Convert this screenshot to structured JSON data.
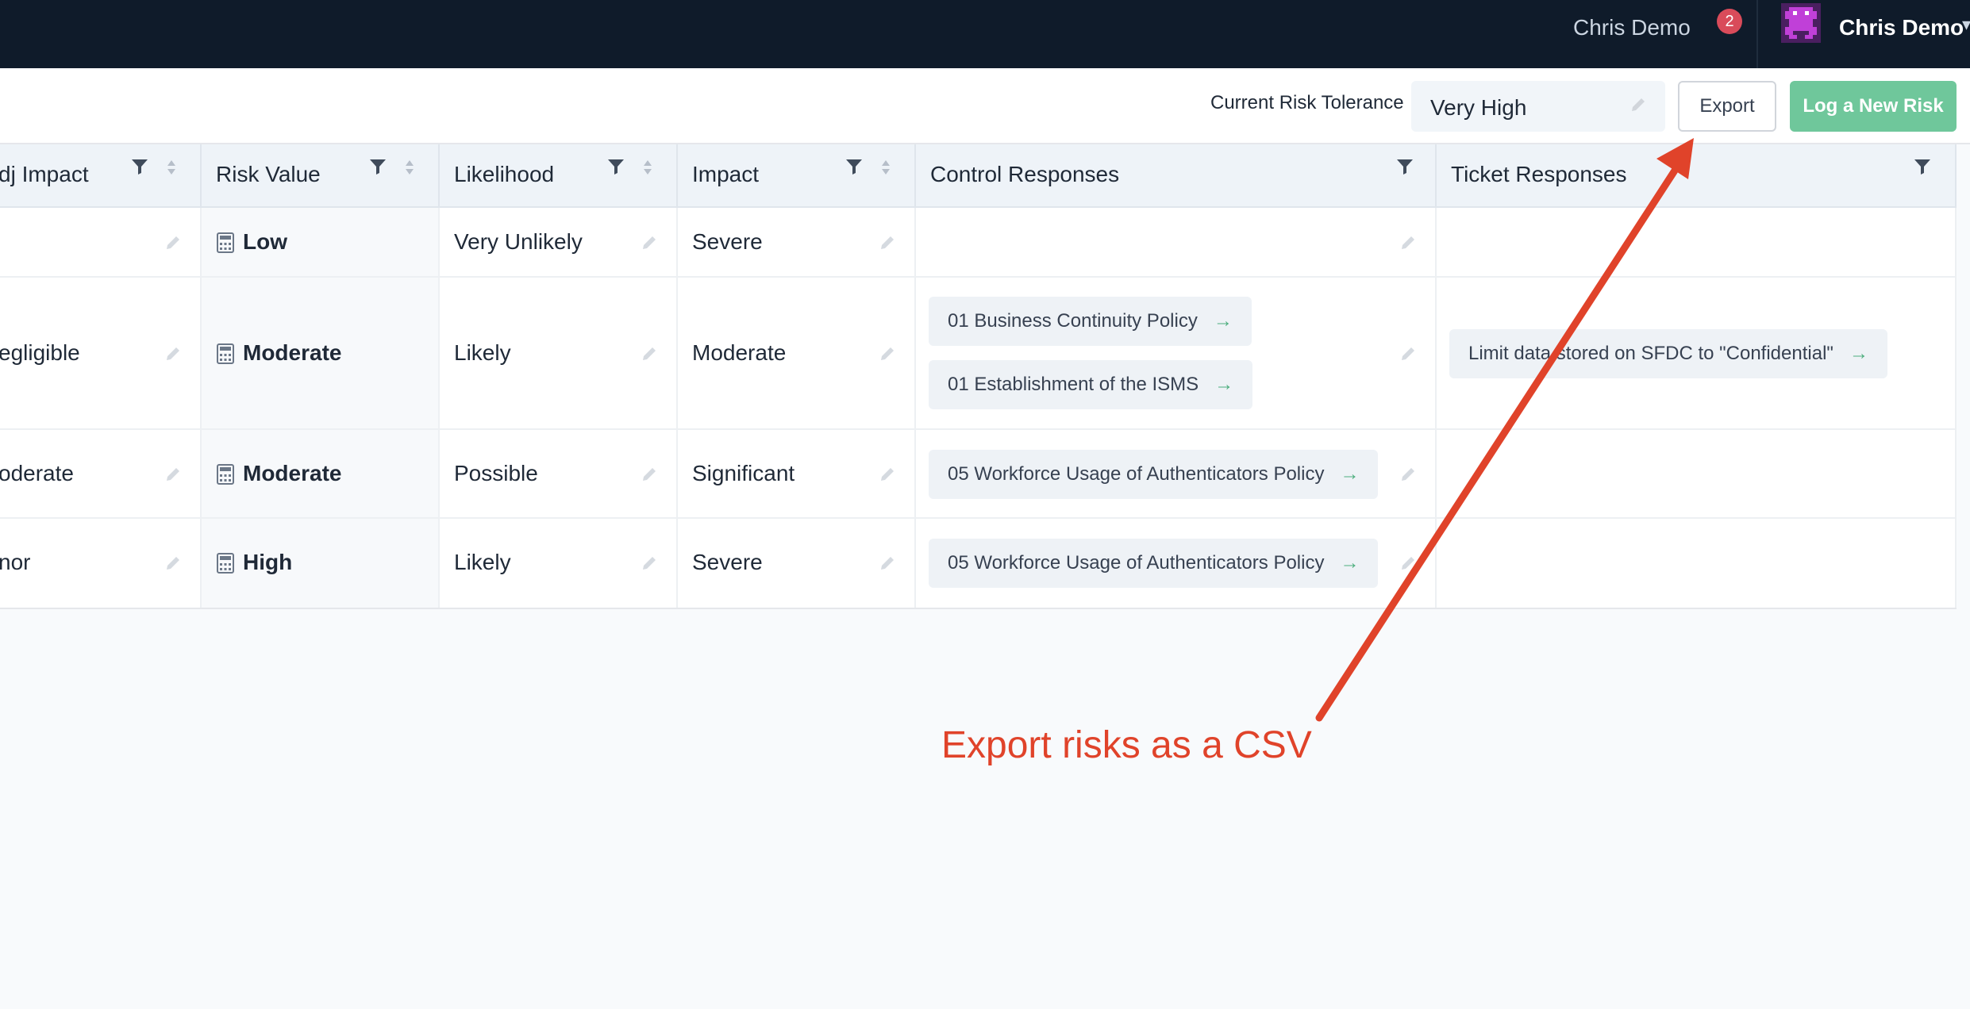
{
  "topbar": {
    "user_link": "Chris Demo",
    "notification_count": "2",
    "account_name": "Chris Demo"
  },
  "toolbar": {
    "tolerance_label": "Current Risk Tolerance",
    "tolerance_value": "Very High",
    "export_label": "Export",
    "log_label": "Log a New Risk"
  },
  "table": {
    "columns": [
      {
        "label": "dj Impact"
      },
      {
        "label": "Risk Value"
      },
      {
        "label": "Likelihood"
      },
      {
        "label": "Impact"
      },
      {
        "label": "Control Responses"
      },
      {
        "label": "Ticket Responses"
      }
    ],
    "rows": [
      {
        "adj_impact": "",
        "risk_value": "Low",
        "likelihood": "Very Unlikely",
        "impact": "Severe",
        "controls": [],
        "tickets": []
      },
      {
        "adj_impact": "egligible",
        "risk_value": "Moderate",
        "likelihood": "Likely",
        "impact": "Moderate",
        "controls": [
          "01 Business Continuity Policy",
          "01 Establishment of the ISMS"
        ],
        "tickets": [
          "Limit data stored on SFDC to \"Confidential\""
        ]
      },
      {
        "adj_impact": "oderate",
        "risk_value": "Moderate",
        "likelihood": "Possible",
        "impact": "Significant",
        "controls": [
          "05 Workforce Usage of Authenticators Policy"
        ],
        "tickets": []
      },
      {
        "adj_impact": "nor",
        "risk_value": "High",
        "likelihood": "Likely",
        "impact": "Severe",
        "controls": [
          "05 Workforce Usage of Authenticators Policy"
        ],
        "tickets": []
      }
    ]
  },
  "annotation": {
    "text": "Export risks as a CSV",
    "color": "#e0432a"
  },
  "colors": {
    "topbar_bg": "#0f1b2a",
    "accent_green": "#6fc79b",
    "badge_red": "#d94b5a"
  }
}
